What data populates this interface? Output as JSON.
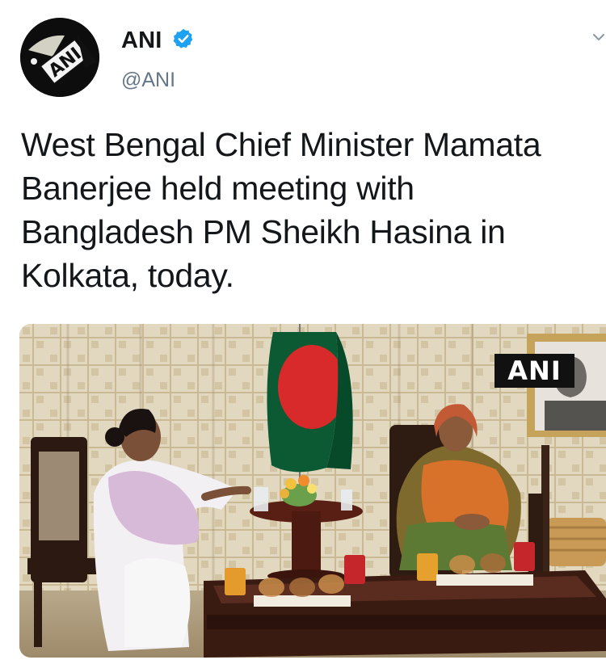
{
  "tweet": {
    "author": {
      "name": "ANI",
      "handle": "@ANI",
      "avatar_text": "ANI",
      "verified_icon": "verified-badge-icon"
    },
    "menu_icon": "chevron-down-icon",
    "text_lines": [
      "West Bengal Chief Minister Mamata",
      "Banerjee held meeting with",
      "Bangladesh PM Sheikh Hasina in",
      "Kolkata, today."
    ],
    "media": {
      "watermark": "ANI"
    }
  },
  "colors": {
    "verified_blue": "#1da1f2",
    "handle_gray": "#657786",
    "text": "#14171a"
  }
}
